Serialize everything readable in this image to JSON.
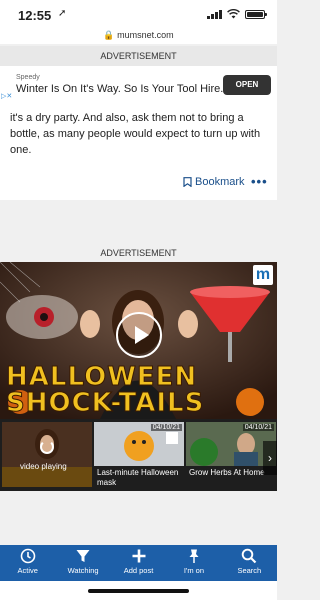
{
  "status_bar": {
    "time": "12:55",
    "location_arrow": "location-arrow-icon"
  },
  "browser": {
    "url": "mumsnet.com"
  },
  "ad_top": {
    "label": "ADVERTISEMENT",
    "sponsor": "Speedy",
    "headline": "Winter Is On It's Way. So Is Your Tool Hire.",
    "button": "OPEN"
  },
  "post": {
    "text": "it's a dry party. And also, ask them not to bring a bottle, as many people would expect to turn up with one.",
    "bookmark_label": "Bookmark",
    "more_label": "•••"
  },
  "ad_mid": {
    "label": "ADVERTISEMENT",
    "logo": "m",
    "video_title_line1": "HALLOWEEN",
    "video_title_line2": "SHOCK-TAILS"
  },
  "thumbnails": [
    {
      "caption": "",
      "overlay": "video playing",
      "date": ""
    },
    {
      "caption": "Last-minute Halloween mask",
      "date": "04/10/21"
    },
    {
      "caption": "Grow Herbs At Home",
      "date": "04/10/21"
    }
  ],
  "bottom_nav": [
    {
      "label": "Active",
      "icon": "clock-icon"
    },
    {
      "label": "Watching",
      "icon": "filter-icon"
    },
    {
      "label": "Add post",
      "icon": "plus-icon"
    },
    {
      "label": "I'm on",
      "icon": "pin-icon"
    },
    {
      "label": "Search",
      "icon": "search-icon"
    }
  ],
  "colors": {
    "nav_blue": "#1d5fa8",
    "link_blue": "#1a4f8a",
    "title_gold": "#f0c020"
  }
}
